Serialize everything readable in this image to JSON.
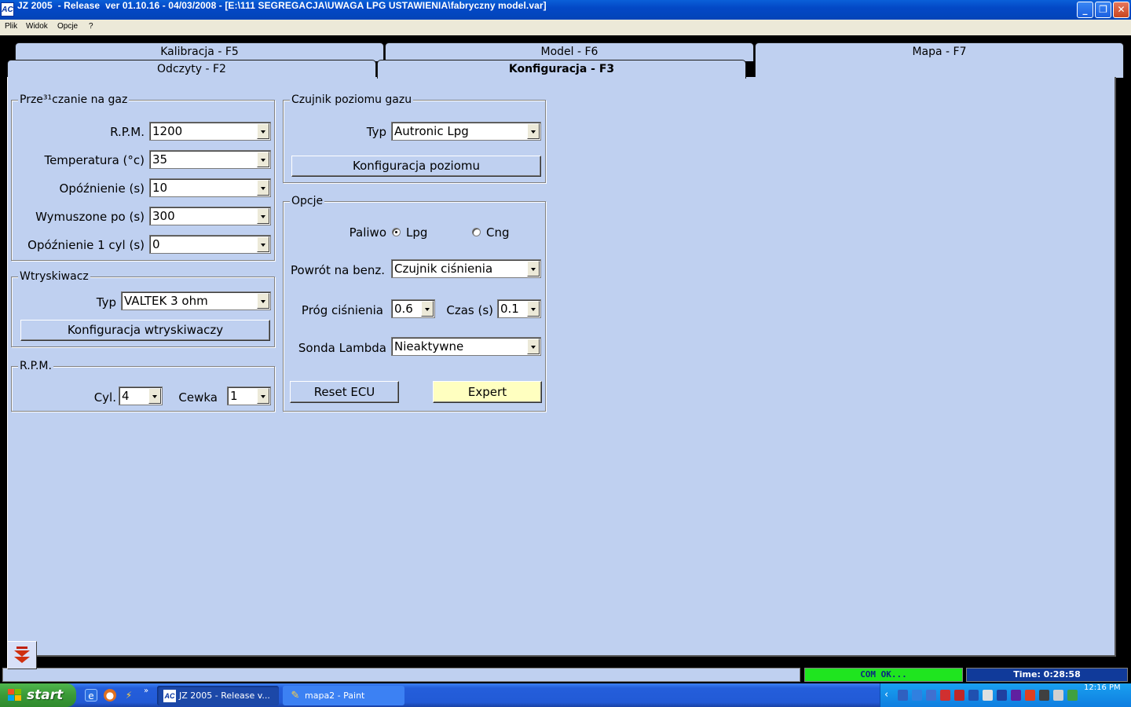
{
  "window": {
    "title": "JZ 2005  - Release  ver 01.10.16 - 04/03/2008 - [E:\\111 SEGREGACJA\\UWAGA LPG USTAWIENIA\\fabryczny model.var]",
    "app_icon_text": "AC"
  },
  "menu": {
    "file": "Plik",
    "view": "Widok",
    "options": "Opcje",
    "help": "?"
  },
  "tabs": {
    "kalibracja": "Kalibracja - F5",
    "model": "Model - F6",
    "mapa": "Mapa - F7",
    "odczyty": "Odczyty - F2",
    "konfiguracja": "Konfiguracja - F3"
  },
  "switching": {
    "title": "Prze³¹czanie na gaz",
    "rpm_label": "R.P.M.",
    "rpm_value": "1200",
    "temp_label": "Temperatura (°c)",
    "temp_value": "35",
    "delay_label": "Opóźnienie (s)",
    "delay_value": "10",
    "forced_label": "Wymuszone po (s)",
    "forced_value": "300",
    "delay1_label": "Opóźnienie 1 cyl (s)",
    "delay1_value": "0"
  },
  "injector": {
    "title": "Wtryskiwacz",
    "type_label": "Typ",
    "type_value": "VALTEK 3 ohm",
    "config_button": "Konfiguracja wtryskiwaczy"
  },
  "rpm_group": {
    "title": "R.P.M.",
    "cyl_label": "Cyl.",
    "cyl_value": "4",
    "coil_label": "Cewka",
    "coil_value": "1"
  },
  "level_sensor": {
    "title": "Czujnik poziomu gazu",
    "type_label": "Typ",
    "type_value": "Autronic Lpg",
    "config_button": "Konfiguracja poziomu"
  },
  "options": {
    "title": "Opcje",
    "fuel_label": "Paliwo",
    "fuel_lpg": "Lpg",
    "fuel_cng": "Cng",
    "fuel_selected": "Lpg",
    "return_label": "Powrót na benz.",
    "return_value": "Czujnik ciśnienia",
    "threshold_label": "Próg ciśnienia",
    "threshold_value": "0.6",
    "time_label": "Czas (s)",
    "time_value": "0.1",
    "lambda_label": "Sonda Lambda",
    "lambda_value": "Nieaktywne",
    "reset_button": "Reset ECU",
    "expert_button": "Expert"
  },
  "status": {
    "com": "COM OK...",
    "time": "Time: 0:28:58"
  },
  "taskbar": {
    "start": "start",
    "tasks": [
      {
        "label": "JZ 2005 - Release  v...",
        "active": true
      },
      {
        "label": "mapa2 - Paint",
        "active": false
      }
    ],
    "clock": "12:16 PM"
  },
  "colors": {
    "panel_bg": "#bfd0f0",
    "expert_bg": "#ffffc0",
    "com_ok": "#1fe51f",
    "time_bg": "#103a9a"
  }
}
